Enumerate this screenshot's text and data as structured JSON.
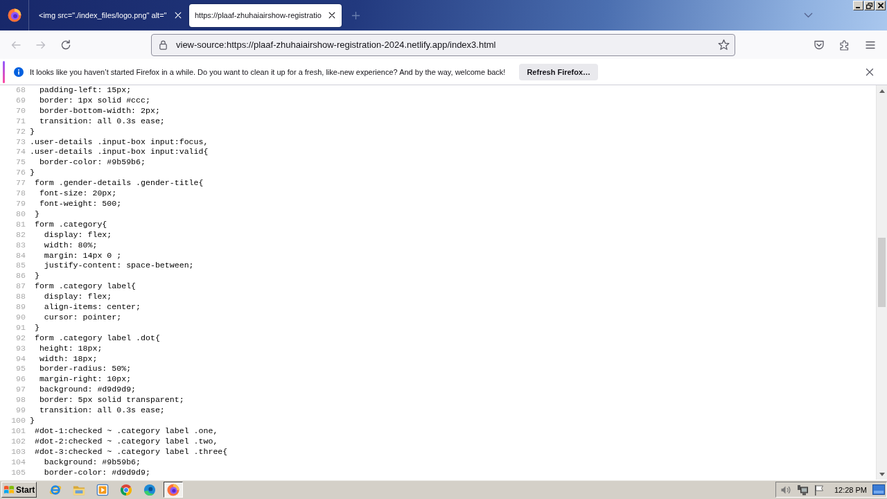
{
  "window": {
    "tabs": [
      {
        "label": "<img src=\"./index_files/logo.png\" alt=\"",
        "selected": false
      },
      {
        "label": "https://plaaf-zhuhaiairshow-registratio",
        "selected": true
      }
    ]
  },
  "toolbar": {
    "nav_buttons": [
      {
        "kind": "back",
        "disabled": true
      },
      {
        "kind": "forward",
        "disabled": true
      },
      {
        "kind": "reload",
        "disabled": false
      }
    ],
    "address": "view-source:https://plaaf-zhuhaiairshow-registration-2024.netlify.app/index3.html"
  },
  "notification": {
    "message": "It looks like you haven’t started Firefox in a while. Do you want to clean it up for a fresh, like-new experience? And by the way, welcome back!",
    "button": "Refresh Firefox…"
  },
  "source": {
    "lines": [
      {
        "number": "68",
        "code": "  padding-left: 15px;"
      },
      {
        "number": "69",
        "code": "  border: 1px solid #ccc;"
      },
      {
        "number": "70",
        "code": "  border-bottom-width: 2px;"
      },
      {
        "number": "71",
        "code": "  transition: all 0.3s ease;"
      },
      {
        "number": "72",
        "code": "}"
      },
      {
        "number": "73",
        "code": ".user-details .input-box input:focus,"
      },
      {
        "number": "74",
        "code": ".user-details .input-box input:valid{"
      },
      {
        "number": "75",
        "code": "  border-color: #9b59b6;"
      },
      {
        "number": "76",
        "code": "}"
      },
      {
        "number": "77",
        "code": " form .gender-details .gender-title{"
      },
      {
        "number": "78",
        "code": "  font-size: 20px;"
      },
      {
        "number": "79",
        "code": "  font-weight: 500;"
      },
      {
        "number": "80",
        "code": " }"
      },
      {
        "number": "81",
        "code": " form .category{"
      },
      {
        "number": "82",
        "code": "   display: flex;"
      },
      {
        "number": "83",
        "code": "   width: 80%;"
      },
      {
        "number": "84",
        "code": "   margin: 14px 0 ;"
      },
      {
        "number": "85",
        "code": "   justify-content: space-between;"
      },
      {
        "number": "86",
        "code": " }"
      },
      {
        "number": "87",
        "code": " form .category label{"
      },
      {
        "number": "88",
        "code": "   display: flex;"
      },
      {
        "number": "89",
        "code": "   align-items: center;"
      },
      {
        "number": "90",
        "code": "   cursor: pointer;"
      },
      {
        "number": "91",
        "code": " }"
      },
      {
        "number": "92",
        "code": " form .category label .dot{"
      },
      {
        "number": "93",
        "code": "  height: 18px;"
      },
      {
        "number": "94",
        "code": "  width: 18px;"
      },
      {
        "number": "95",
        "code": "  border-radius: 50%;"
      },
      {
        "number": "96",
        "code": "  margin-right: 10px;"
      },
      {
        "number": "97",
        "code": "  background: #d9d9d9;"
      },
      {
        "number": "98",
        "code": "  border: 5px solid transparent;"
      },
      {
        "number": "99",
        "code": "  transition: all 0.3s ease;"
      },
      {
        "number": "100",
        "code": "}"
      },
      {
        "number": "101",
        "code": " #dot-1:checked ~ .category label .one,"
      },
      {
        "number": "102",
        "code": " #dot-2:checked ~ .category label .two,"
      },
      {
        "number": "103",
        "code": " #dot-3:checked ~ .category label .three{"
      },
      {
        "number": "104",
        "code": "   background: #9b59b6;"
      },
      {
        "number": "105",
        "code": "   border-color: #d9d9d9;"
      }
    ]
  },
  "taskbar": {
    "start": "Start",
    "apps": [
      {
        "kind": "ie",
        "selected": false
      },
      {
        "kind": "explorer",
        "selected": false
      },
      {
        "kind": "player",
        "selected": false
      },
      {
        "kind": "chrome",
        "selected": false
      },
      {
        "kind": "edge",
        "selected": false
      },
      {
        "kind": "firefox",
        "selected": true
      }
    ],
    "clock": "12:28 PM"
  }
}
